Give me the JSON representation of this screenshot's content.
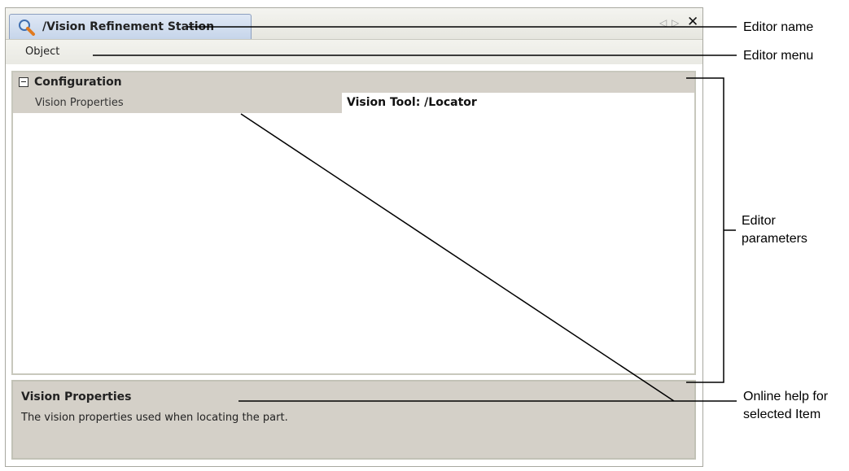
{
  "editor": {
    "tab_title": "/Vision Refinement Station",
    "tab_icon": "search-magnifier-icon",
    "nav_prev": "◁",
    "nav_next": "▷",
    "close": "✕",
    "menu": [
      "Object"
    ],
    "category": {
      "toggle": "−",
      "label": "Configuration"
    },
    "property": {
      "name": "Vision Properties",
      "value": "Vision Tool: /Locator"
    },
    "help": {
      "title": "Vision Properties",
      "description": "The vision properties used when locating the part."
    }
  },
  "annotations": {
    "editor_name": "Editor name",
    "editor_menu": "Editor menu",
    "editor_parameters_1": "Editor",
    "editor_parameters_2": "parameters",
    "online_help_1": "Online help for",
    "online_help_2": "selected Item"
  }
}
